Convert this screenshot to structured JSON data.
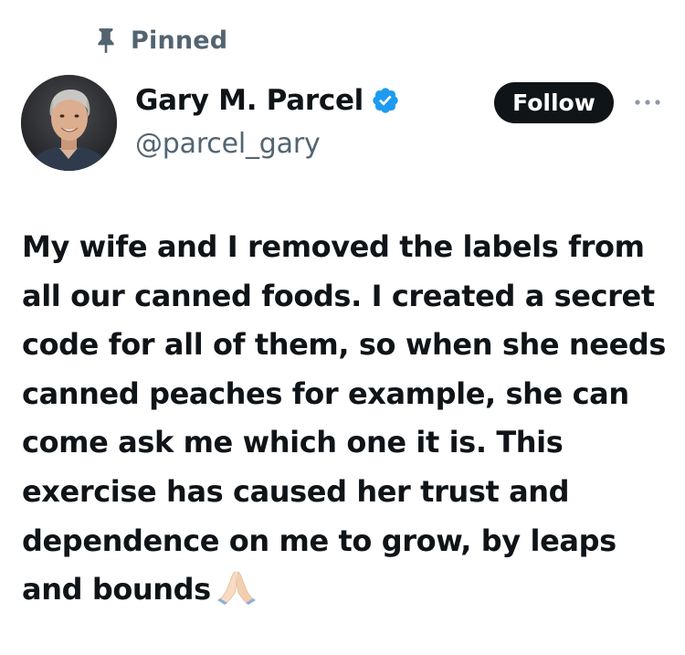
{
  "pinned": {
    "label": "Pinned",
    "icon": "pin-icon"
  },
  "author": {
    "display_name": "Gary M. Parcel",
    "handle": "@parcel_gary",
    "verified": true,
    "verified_color": "#1d9bf0",
    "avatar": "avatar"
  },
  "actions": {
    "follow_label": "Follow",
    "more_icon": "more-icon"
  },
  "tweet": {
    "text": "My wife and I removed the labels from all our canned foods. I created a secret code for all of them, so when she needs canned peaches for example, she can come ask me which one it is. This exercise has caused her trust and dependence on me to grow, by leaps and bounds",
    "emoji": "folded-hands-emoji"
  },
  "colors": {
    "text_primary": "#0f1419",
    "text_secondary": "#536471",
    "follow_bg": "#0f1419",
    "follow_text": "#ffffff"
  }
}
